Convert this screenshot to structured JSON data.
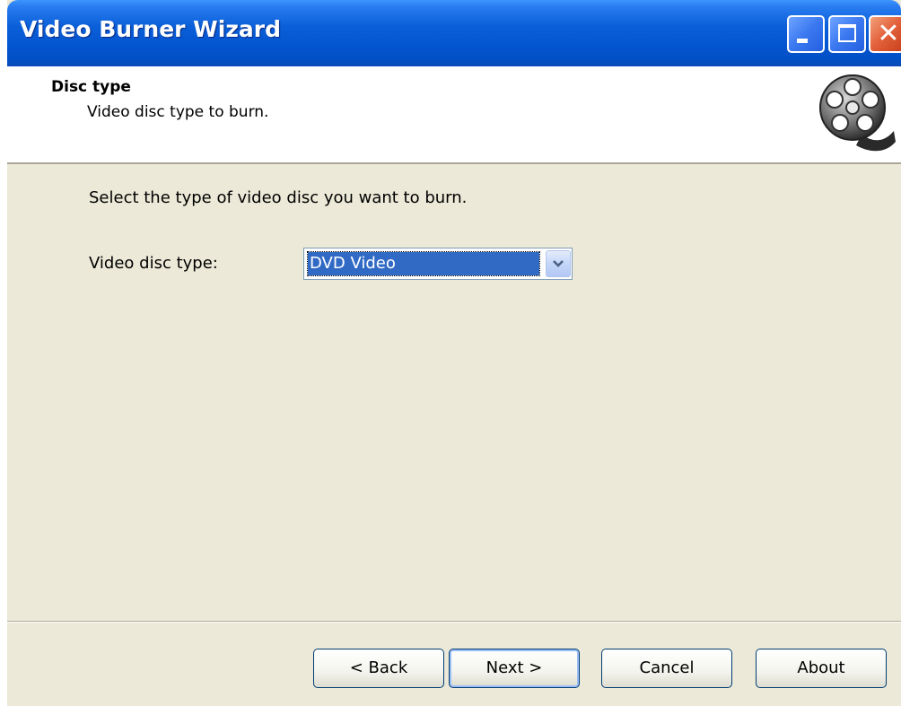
{
  "window": {
    "title": "Video Burner Wizard",
    "controls": {
      "minimize": "minimize-icon",
      "maximize": "maximize-icon",
      "close": "close-icon"
    }
  },
  "header": {
    "title": "Disc type",
    "subtitle": "Video disc type to burn.",
    "icon": "film-reel-icon"
  },
  "main": {
    "instruction": "Select the type of video disc you want to burn.",
    "disc_type_label": "Video disc type:",
    "disc_type_value": "DVD Video"
  },
  "footer": {
    "back_label": "< Back",
    "next_label": "Next >",
    "cancel_label": "Cancel",
    "about_label": "About"
  },
  "colors": {
    "titlebar": "#0454d0",
    "dialog_bg": "#ece9d8",
    "selection": "#316ac5"
  }
}
